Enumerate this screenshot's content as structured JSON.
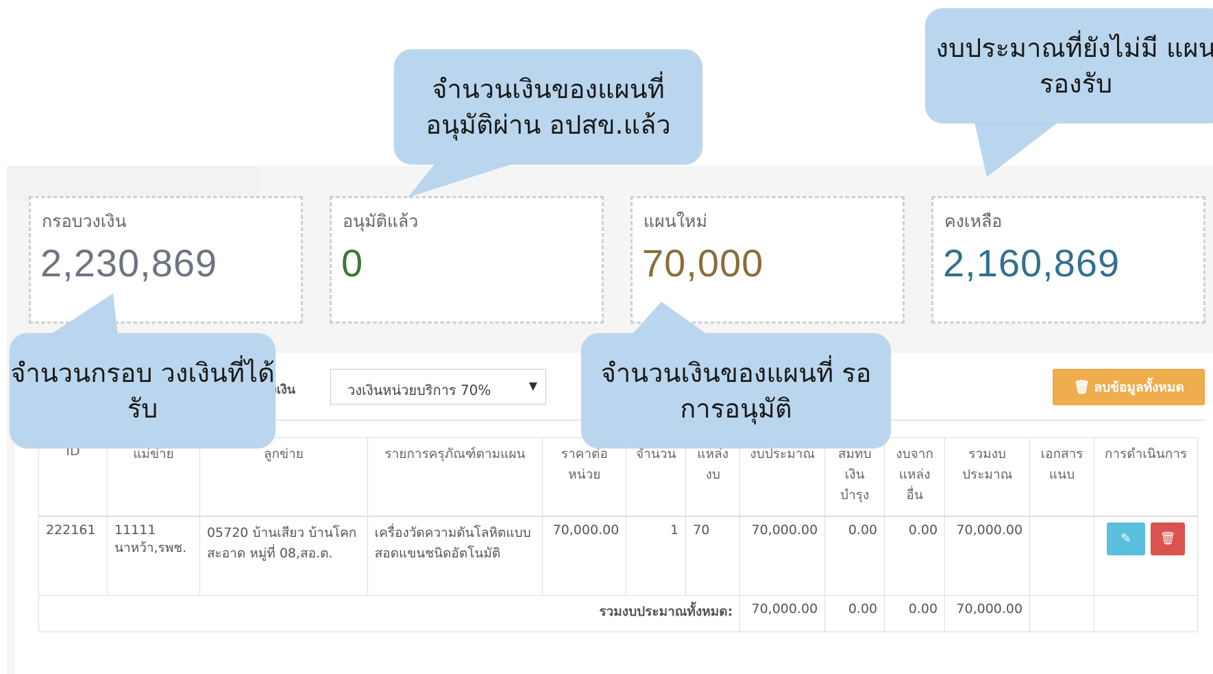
{
  "stats": [
    {
      "label": "กรอบวงเงิน",
      "value": "2,230,869",
      "color": "#6c7480"
    },
    {
      "label": "อนุมัติแล้ว",
      "value": "0",
      "color": "#3c763d"
    },
    {
      "label": "แผนใหม่",
      "value": "70,000",
      "color": "#8a6d3b"
    },
    {
      "label": "คงเหลือ",
      "value": "2,160,869",
      "color": "#31708f"
    }
  ],
  "toolbar": {
    "funding_label": "งเงิน",
    "funding_select": "วงเงินหน่วยบริการ 70%",
    "delete_all_label": "ลบข้อมูลทั้งหมด"
  },
  "table": {
    "headers": [
      "ID",
      "แม่ข่าย",
      "ลูกข่าย",
      "รายการครุภัณฑ์ตามแผน",
      "ราคาต่อหน่วย",
      "จำนวน",
      "แหล่งงบ",
      "งบประมาณ",
      "สมทบเงินบำรุง",
      "งบจากแหล่งอื่น",
      "รวมงบประมาณ",
      "เอกสารแนบ",
      "การดำเนินการ"
    ],
    "rows": [
      {
        "id": "222161",
        "parent": "11111 นาหว้า,รพช.",
        "child": "05720 บ้านเสียว บ้านโคกสะอาด หมู่ที่ 08,สอ.ต.",
        "item": "เครื่องวัดความดันโลหิตแบบสอดแขนชนิดอัตโนมัติ",
        "unit_price": "70,000.00",
        "qty": "1",
        "source": "70",
        "budget": "70,000.00",
        "matching": "0.00",
        "other": "0.00",
        "total": "70,000.00",
        "attachment": ""
      }
    ],
    "total_row": {
      "label": "รวมงบประมาณทั้งหมด:",
      "budget": "70,000.00",
      "matching": "0.00",
      "other": "0.00",
      "total": "70,000.00"
    }
  },
  "callouts": {
    "approved_amount": "จำนวนเงินของแผนที่ อนุมัติผ่าน อปสข.แล้ว",
    "unplanned_budget": "งบประมาณที่ยังไม่มี แผนรองรับ",
    "budget_frame": "จำนวนกรอบ วงเงินที่ได้รับ",
    "pending_amount": "จำนวนเงินของแผนที่ รอการอนุมัติ"
  },
  "colors": {
    "callout_bg": "#bad6ee",
    "warning": "#f0ad4e",
    "info": "#5bc0de",
    "danger": "#d9534f"
  }
}
